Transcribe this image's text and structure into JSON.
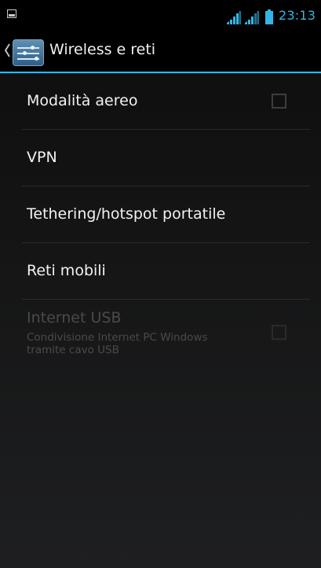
{
  "status_bar": {
    "time": "23:13",
    "notification_icon": "screenshot-notification-icon",
    "signal_icons": [
      "signal-strength-icon",
      "signal-strength-icon"
    ],
    "battery_icon": "battery-icon",
    "time_color": "#33b5e5"
  },
  "action_bar": {
    "title": "Wireless e reti",
    "back_icon": "chevron-left-icon",
    "app_icon": "settings-sliders-icon",
    "accent_color": "#33b5e5"
  },
  "settings_list": {
    "items": [
      {
        "label": "Modalità aereo",
        "has_checkbox": true,
        "checked": false,
        "enabled": true
      },
      {
        "label": "VPN",
        "has_checkbox": false,
        "enabled": true
      },
      {
        "label": "Tethering/hotspot portatile",
        "has_checkbox": false,
        "enabled": true
      },
      {
        "label": "Reti mobili",
        "has_checkbox": false,
        "enabled": true
      },
      {
        "label": "Internet USB",
        "summary": "Condivisione Internet PC Windows tramite cavo USB",
        "has_checkbox": true,
        "checked": false,
        "enabled": false
      }
    ]
  }
}
